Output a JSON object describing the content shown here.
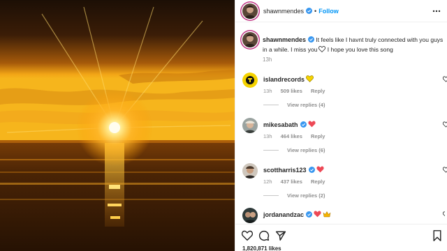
{
  "post": {
    "author": "shawnmendes",
    "follow_label": "Follow",
    "dot": "•",
    "caption_author": "shawnmendes",
    "caption_text": "It feels like I havnt truly connected with you guys in a while. I miss you",
    "caption_text_after": " I hope you love this song",
    "caption_time": "13h",
    "likes": "1,820,871 likes"
  },
  "comments": [
    {
      "username": "islandrecords",
      "time": "13h",
      "likes": "509 likes",
      "reply": "Reply",
      "view_replies": "View replies (4)",
      "emoji": [
        "yellow-heart-icon"
      ]
    },
    {
      "username": "mikesabath",
      "time": "13h",
      "likes": "464 likes",
      "reply": "Reply",
      "view_replies": "View replies (6)",
      "emoji": [
        "red-heart-icon"
      ]
    },
    {
      "username": "scottharris123",
      "time": "12h",
      "likes": "437 likes",
      "reply": "Reply",
      "view_replies": "View replies (2)",
      "emoji": [
        "red-heart-icon"
      ]
    },
    {
      "username": "jordanandzac",
      "emoji": [
        "red-heart-icon",
        "crown-icon"
      ]
    }
  ],
  "colors": {
    "link_blue": "#0095f6",
    "verified_blue": "#3897f0",
    "text": "#262626",
    "muted": "#8e8e8e",
    "heart_red": "#ed4956",
    "heart_yellow": "#f5d300"
  },
  "icons": [
    "verified-badge-icon",
    "more-options-icon",
    "like-heart-icon",
    "comment-icon",
    "share-icon",
    "save-bookmark-icon"
  ]
}
